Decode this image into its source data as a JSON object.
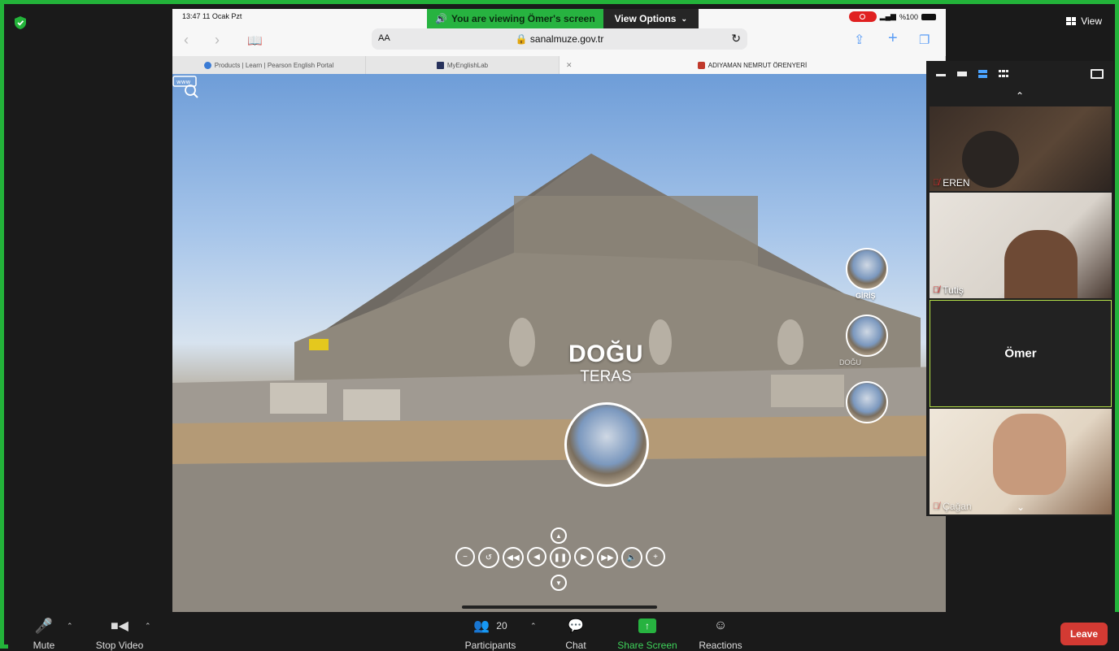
{
  "zoom": {
    "view_label": "View",
    "banner": {
      "viewing": "You are viewing Ömer's screen",
      "options": "View Options"
    }
  },
  "ipad": {
    "time": "13:47  11 Ocak Pzt",
    "battery": "%100",
    "url_aa": "AA",
    "host": "sanalmuze.gov.tr",
    "tabs": [
      {
        "title": "Products | Learn | Pearson English Portal"
      },
      {
        "title": "MyEnglishLab"
      },
      {
        "title": ""
      },
      {
        "title": "ADIYAMAN NEMRUT ÖRENYERİ"
      }
    ]
  },
  "tour": {
    "title": "DOĞU",
    "subtitle": "TERAS",
    "nav_thumbs": [
      {
        "caption": "GİRİŞ"
      },
      {
        "caption": "DOĞU"
      },
      {
        "caption": ""
      }
    ]
  },
  "participants_panel": {
    "tiles": [
      {
        "name": "EREN",
        "muted": true
      },
      {
        "name": "Tutiş",
        "muted": true
      },
      {
        "name": "Ömer",
        "muted": false,
        "video_off": true,
        "active": true
      },
      {
        "name": "Çağan",
        "muted": true
      }
    ]
  },
  "toolbar": {
    "mute": "Mute",
    "stop_video": "Stop Video",
    "participants": "Participants",
    "participants_count": "20",
    "chat": "Chat",
    "share_screen": "Share Screen",
    "reactions": "Reactions",
    "leave": "Leave"
  },
  "colors": {
    "zoom_green": "#23b33a",
    "leave_red": "#d33a33",
    "active_tile": "#b6e34a"
  }
}
